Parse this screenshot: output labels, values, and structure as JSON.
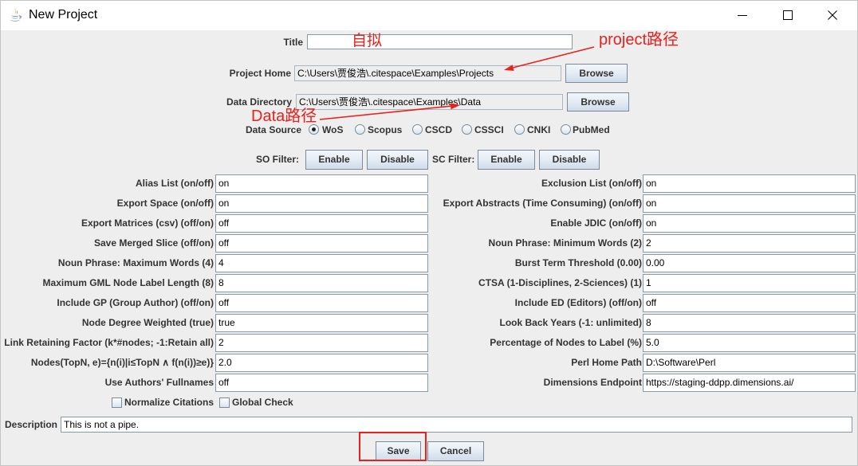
{
  "window": {
    "title": "New Project"
  },
  "icons": {
    "app": "java-icon",
    "minimize": "minimize-icon",
    "maximize": "maximize-icon",
    "close": "close-icon"
  },
  "title_field": {
    "label": "Title",
    "value": ""
  },
  "project_home": {
    "label": "Project Home",
    "value": "C:\\Users\\贾俊浩\\.citespace\\Examples\\Projects",
    "browse_label": "Browse"
  },
  "data_directory": {
    "label": "Data Directory",
    "value": "C:\\Users\\贾俊浩\\.citespace\\Examples\\Data",
    "browse_label": "Browse"
  },
  "data_source": {
    "label": "Data Source",
    "options": [
      "WoS",
      "Scopus",
      "CSCD",
      "CSSCI",
      "CNKI",
      "PubMed"
    ],
    "selected_index": 0
  },
  "so_filter": {
    "label": "SO Filter:",
    "enable_label": "Enable",
    "disable_label": "Disable"
  },
  "sc_filter": {
    "label": "SC Filter:",
    "enable_label": "Enable",
    "disable_label": "Disable"
  },
  "left_params": [
    {
      "label": "Alias List (on/off)",
      "value": "on"
    },
    {
      "label": "Export Space (on/off)",
      "value": "on"
    },
    {
      "label": "Export Matrices (csv) (off/on)",
      "value": "off"
    },
    {
      "label": "Save Merged Slice (off/on)",
      "value": "off"
    },
    {
      "label": "Noun Phrase: Maximum Words (4)",
      "value": "4"
    },
    {
      "label": "Maximum GML Node Label Length (8)",
      "value": "8"
    },
    {
      "label": "Include GP (Group Author) (off/on)",
      "value": "off"
    },
    {
      "label": "Node Degree Weighted (true)",
      "value": "true"
    },
    {
      "label": "Link Retaining Factor (k*#nodes; -1:Retain all)",
      "value": "2"
    },
    {
      "label": "Nodes(TopN, e)={n(i)|i≤TopN ∧ f(n(i))≥e)}",
      "value": "2.0"
    },
    {
      "label": "Use Authors' Fullnames",
      "value": "off"
    }
  ],
  "right_params": [
    {
      "label": "Exclusion List (on/off)",
      "value": "on"
    },
    {
      "label": "Export Abstracts (Time Consuming) (on/off)",
      "value": "on"
    },
    {
      "label": "Enable JDIC (on/off)",
      "value": "on"
    },
    {
      "label": "Noun Phrase: Minimum Words (2)",
      "value": "2"
    },
    {
      "label": "Burst Term Threshold (0.00)",
      "value": "0.00"
    },
    {
      "label": "CTSA (1-Disciplines, 2-Sciences) (1)",
      "value": "1"
    },
    {
      "label": "Include ED (Editors) (off/on)",
      "value": "off"
    },
    {
      "label": "Look Back Years (-1: unlimited)",
      "value": "8"
    },
    {
      "label": "Percentage of Nodes to Label (%)",
      "value": "5.0"
    },
    {
      "label": "Perl Home Path",
      "value": "D:\\Software\\Perl"
    },
    {
      "label": "Dimensions Endpoint",
      "value": "https://staging-ddpp.dimensions.ai/"
    }
  ],
  "checkboxes": [
    {
      "label": "Normalize Citations",
      "checked": false
    },
    {
      "label": "Global Check",
      "checked": false
    }
  ],
  "description": {
    "label": "Description",
    "value": "This is not a pipe."
  },
  "actions": {
    "save_label": "Save",
    "cancel_label": "Cancel"
  },
  "annotations": {
    "title_note": "自拟",
    "project_note": "project路径",
    "data_note": "Data路径"
  },
  "colors": {
    "annotation": "#e8211d",
    "panel": "#eeeeee"
  }
}
